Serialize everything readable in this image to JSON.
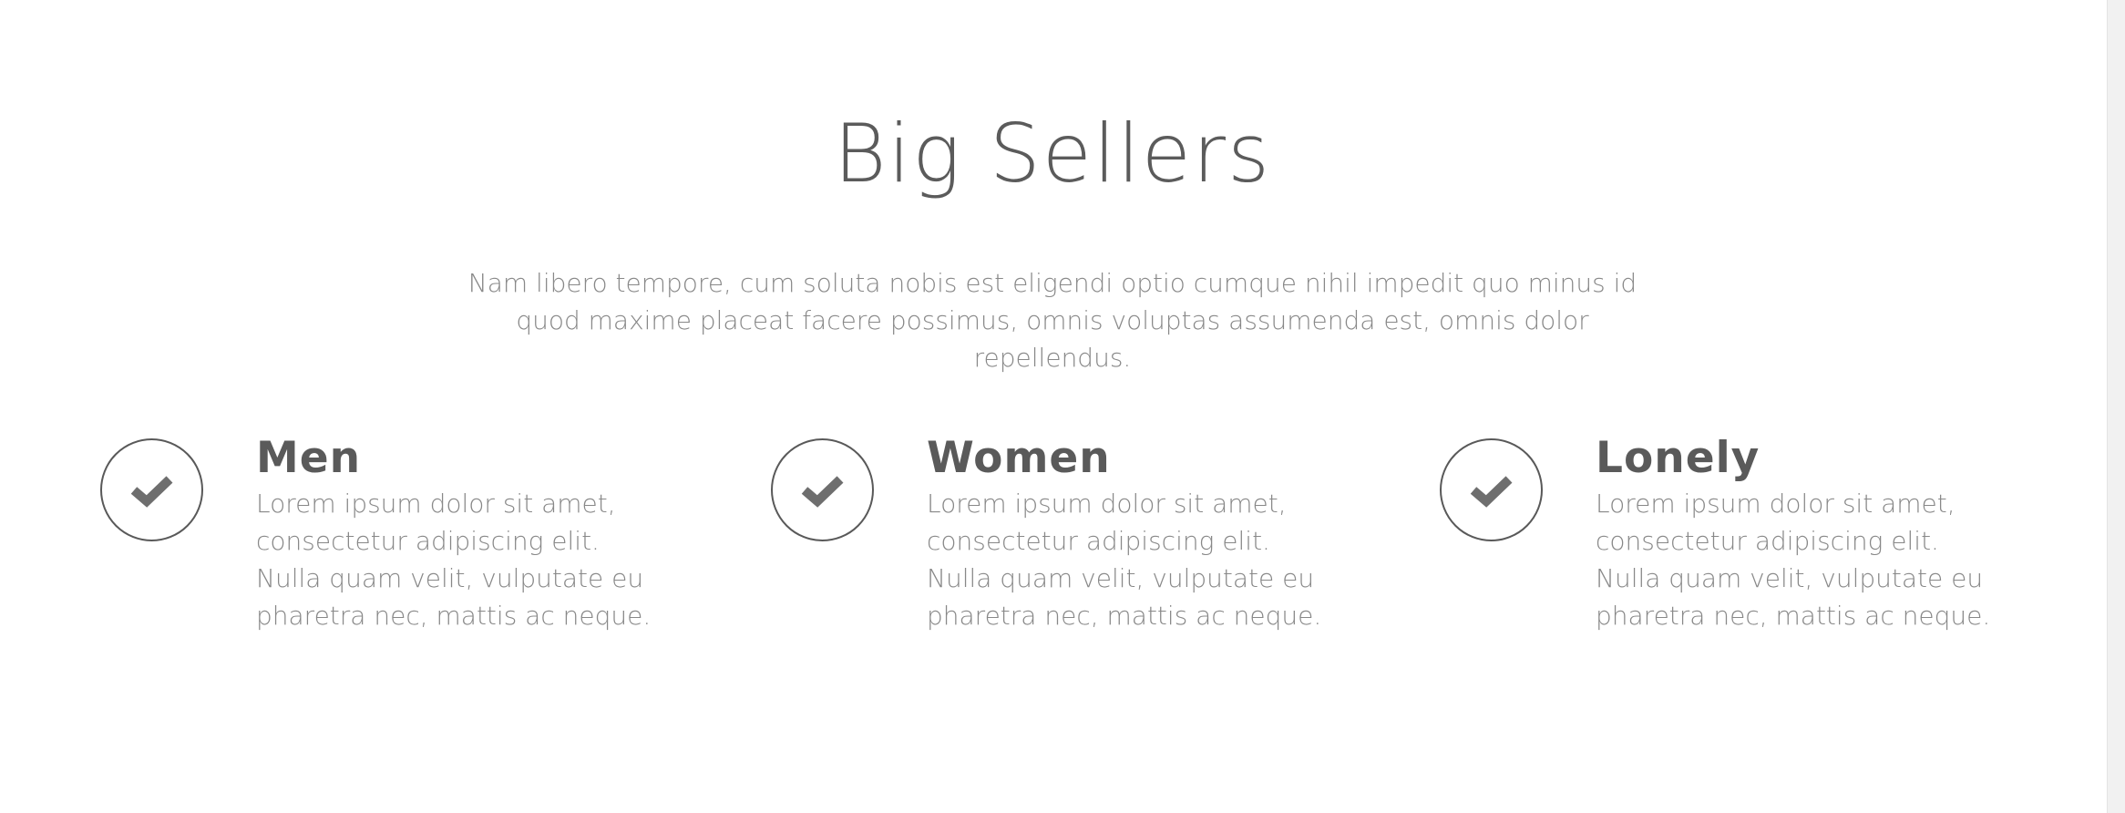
{
  "section": {
    "title": "Big Sellers",
    "lead": "Nam libero tempore, cum soluta nobis est eligendi optio cumque nihil impedit quo minus id quod maxime placeat facere possimus, omnis voluptas assumenda est, omnis dolor repellendus."
  },
  "features": [
    {
      "icon": "check-circle-icon",
      "title": "Men",
      "text": "Lorem ipsum dolor sit amet, consectetur adipiscing elit. Nulla quam velit, vulputate eu pharetra nec, mattis ac neque."
    },
    {
      "icon": "check-circle-icon",
      "title": "Women",
      "text": "Lorem ipsum dolor sit amet, consectetur adipiscing elit. Nulla quam velit, vulputate eu pharetra nec, mattis ac neque."
    },
    {
      "icon": "check-circle-icon",
      "title": "Lonely",
      "text": "Lorem ipsum dolor sit amet, consectetur adipiscing elit. Nulla quam velit, vulputate eu pharetra nec, mattis ac neque."
    }
  ],
  "colors": {
    "heading": "#5b5b5b",
    "body_text": "#888888",
    "icon_stroke": "#595959",
    "checkmark": "#6e6e6e",
    "background": "#ffffff"
  }
}
